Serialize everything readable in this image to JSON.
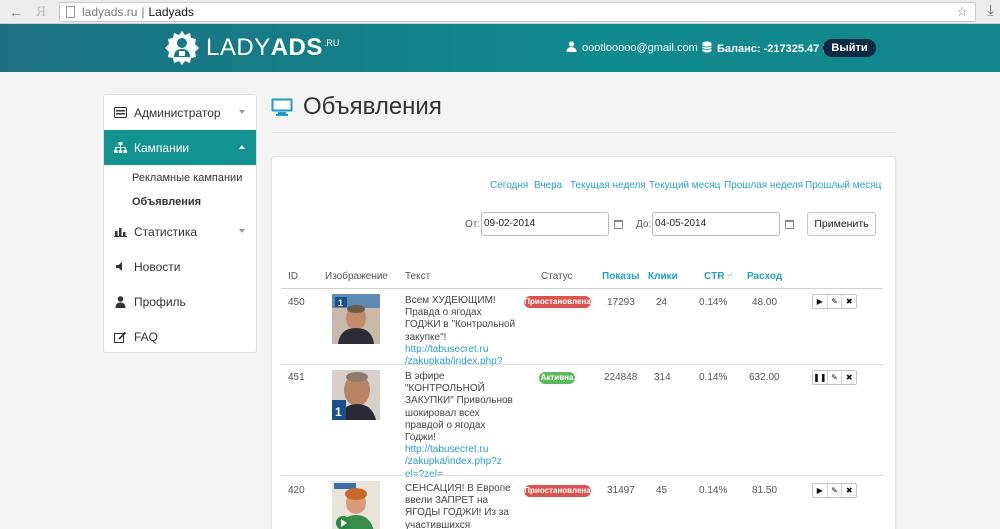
{
  "browser": {
    "domain": "ladyads.ru",
    "separator": "|",
    "title": "Ladyads",
    "back_icon": "←",
    "ya_icon": "Я"
  },
  "header": {
    "logo_main": "LADY",
    "logo_bold": "ADS",
    "logo_sup": ".RU",
    "user_email": "oootlooooo@gmail.com",
    "balance_text": "Баланс: -217325.47 Р",
    "logout_label": "Выйти"
  },
  "sidebar": {
    "admin": "Администратор",
    "campaigns": "Кампании",
    "sub_ad_campaigns": "Рекламные кампании",
    "sub_ads": "Объявления",
    "stats": "Статистика",
    "news": "Новости",
    "profile": "Профиль",
    "faq": "FAQ"
  },
  "page": {
    "title": "Объявления"
  },
  "filters": {
    "quick": [
      "Сегодня",
      "Вчера",
      "Текущая неделя",
      "Текущий месяц",
      "Прошлая неделя",
      "Прошлый месяц"
    ],
    "from_label": "От:",
    "from_value": "09-02-2014",
    "to_label": "До:",
    "to_value": "04-05-2014",
    "apply_label": "Применить"
  },
  "table": {
    "headers": {
      "id": "ID",
      "image": "Изображение",
      "text": "Текст",
      "status": "Статус",
      "shows": "Показы",
      "clicks": "Клики",
      "ctr": "CTR",
      "spend": "Расход"
    },
    "rows": [
      {
        "id": "450",
        "text": "Всем ХУДЕЮЩИМ! Правда о ягодах ГОДЖИ в \"Контрольной закупке\"!",
        "link": "http://tabusecret.ru /zakupkab/index.php?",
        "status": "Приостановлена",
        "shows": "17293",
        "clicks": "24",
        "ctr": "0.14%",
        "spend": "48.00"
      },
      {
        "id": "451",
        "text": "В эфире \"КОНТРОЛЬНОЙ ЗАКУПКИ\" Привольнов шокировал всех правдой о ягодах Годжи!",
        "link": "http://tabusecret.ru /zakupka/index.php?z el=?zel=",
        "status": "Активна",
        "shows": "224848",
        "clicks": "314",
        "ctr": "0.14%",
        "spend": "632.00"
      },
      {
        "id": "420",
        "text": "СЕНСАЦИЯ! В Европе ввели ЗАПРЕТ на ЯГОДЫ ГОДЖИ! Из за участившихся",
        "link": "",
        "status": "Приостановлена",
        "shows": "31497",
        "clicks": "45",
        "ctr": "0.14%",
        "spend": "81.50"
      }
    ]
  }
}
